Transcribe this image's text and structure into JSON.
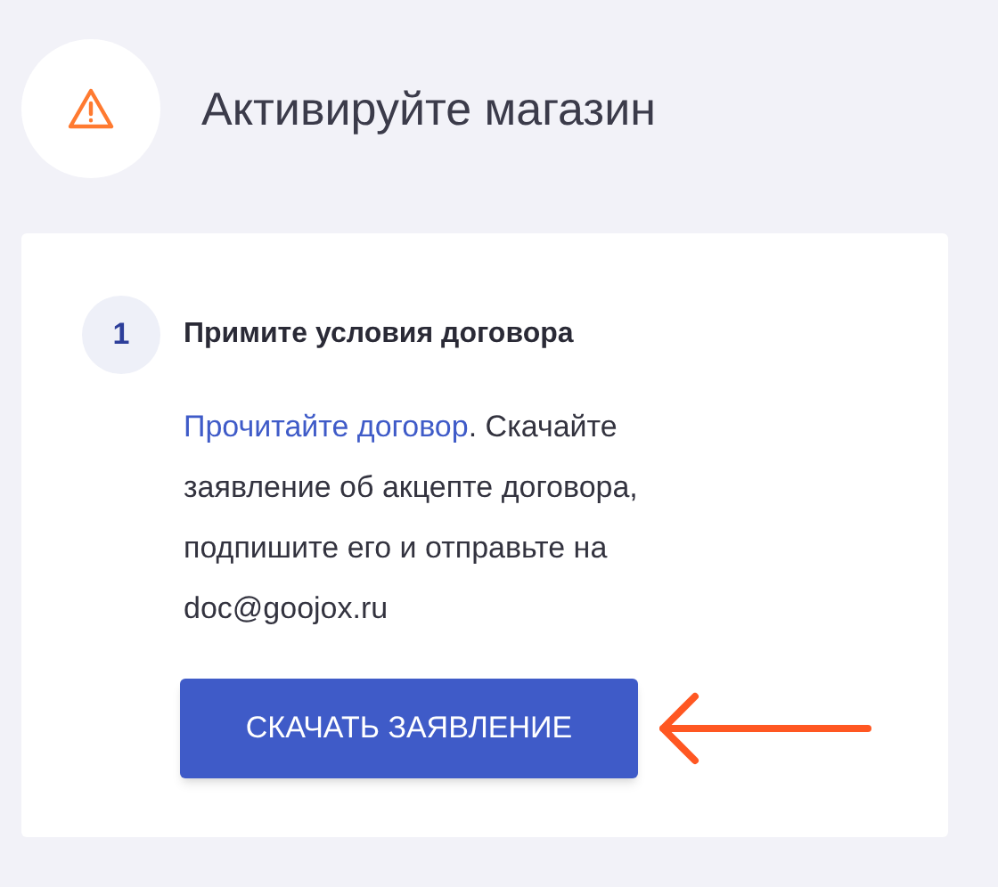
{
  "header": {
    "title": "Активируйте магазин"
  },
  "step": {
    "number": "1",
    "title": "Примите условия договора",
    "link": "Прочитайте договор",
    "text": ". Скачайте заявление об акцепте договора, подпишите его и отправьте на doc@goojox.ru",
    "button": "СКАЧАТЬ ЗАЯВЛЕНИЕ"
  }
}
